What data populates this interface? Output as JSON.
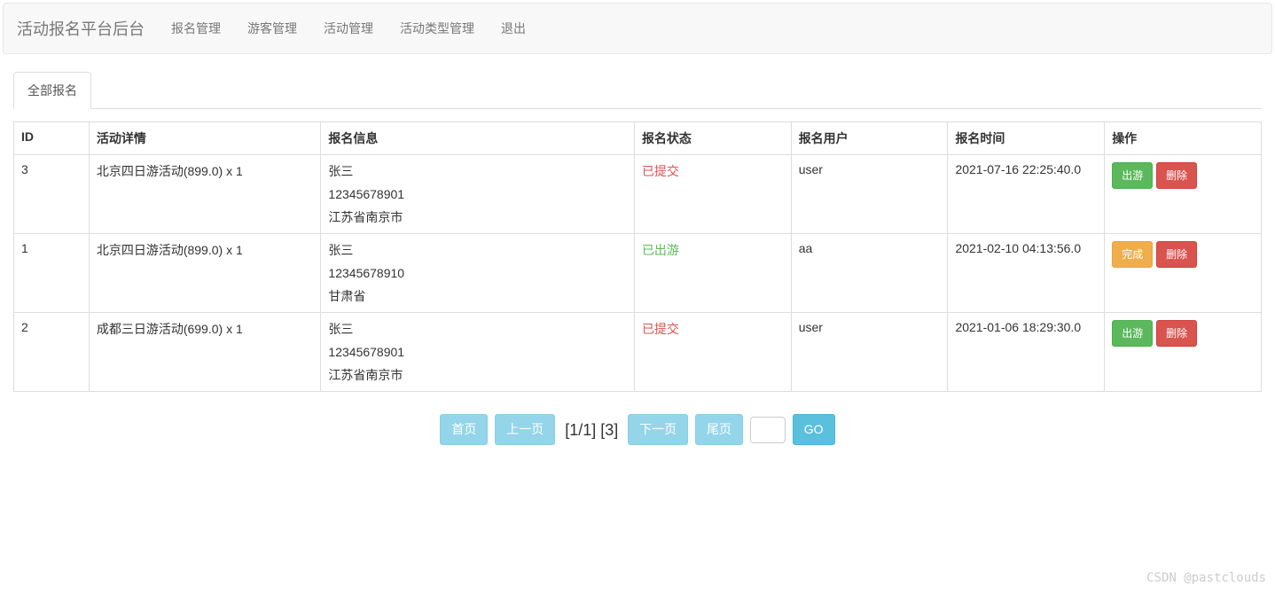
{
  "navbar": {
    "brand": "活动报名平台后台",
    "items": [
      {
        "label": "报名管理"
      },
      {
        "label": "游客管理"
      },
      {
        "label": "活动管理"
      },
      {
        "label": "活动类型管理"
      },
      {
        "label": "退出"
      }
    ]
  },
  "tabs": [
    {
      "label": "全部报名",
      "active": true
    }
  ],
  "table": {
    "headers": {
      "id": "ID",
      "activity": "活动详情",
      "info": "报名信息",
      "status": "报名状态",
      "user": "报名用户",
      "time": "报名时间",
      "action": "操作"
    },
    "rows": [
      {
        "id": "3",
        "activity": "北京四日游活动(899.0) x 1",
        "info_name": "张三",
        "info_phone": "12345678901",
        "info_addr": "江苏省南京市",
        "status": "已提交",
        "status_class": "text-red",
        "user": "user",
        "time": "2021-07-16 22:25:40.0",
        "action1_label": "出游",
        "action1_class": "btn-success",
        "action2_label": "删除"
      },
      {
        "id": "1",
        "activity": "北京四日游活动(899.0) x 1",
        "info_name": "张三",
        "info_phone": "12345678910",
        "info_addr": "甘肃省",
        "status": "已出游",
        "status_class": "text-green",
        "user": "aa",
        "time": "2021-02-10 04:13:56.0",
        "action1_label": "完成",
        "action1_class": "btn-warning",
        "action2_label": "删除"
      },
      {
        "id": "2",
        "activity": "成都三日游活动(699.0) x 1",
        "info_name": "张三",
        "info_phone": "12345678901",
        "info_addr": "江苏省南京市",
        "status": "已提交",
        "status_class": "text-red",
        "user": "user",
        "time": "2021-01-06 18:29:30.0",
        "action1_label": "出游",
        "action1_class": "btn-success",
        "action2_label": "删除"
      }
    ]
  },
  "pagination": {
    "first": "首页",
    "prev": "上一页",
    "info": "[1/1] [3]",
    "next": "下一页",
    "last": "尾页",
    "go": "GO"
  },
  "watermark": "CSDN @pastclouds"
}
